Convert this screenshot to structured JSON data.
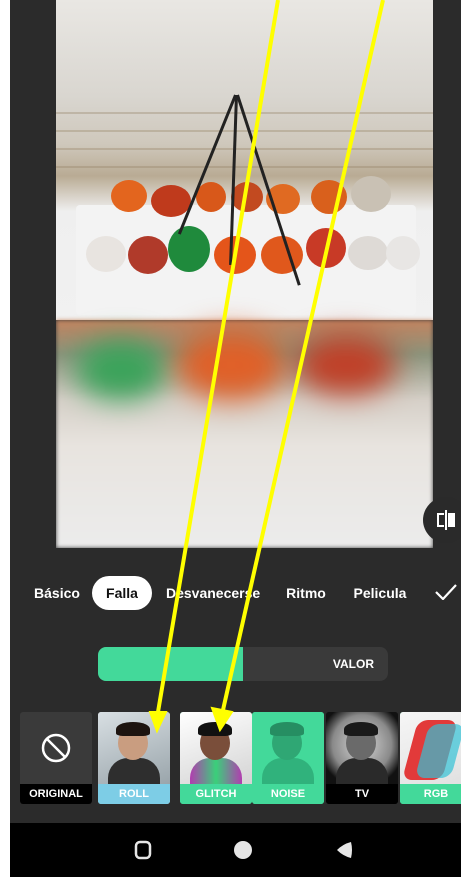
{
  "tabs": [
    {
      "label": "Básico",
      "active": false
    },
    {
      "label": "Falla",
      "active": true
    },
    {
      "label": "Desvanecerse",
      "active": false
    },
    {
      "label": "Ritmo",
      "active": false
    },
    {
      "label": "Pelicula",
      "active": false
    }
  ],
  "slider": {
    "label": "VALOR",
    "fill_fraction": 0.5
  },
  "effects": [
    {
      "label": "ORIGINAL",
      "label_color": "#000000",
      "selected": false
    },
    {
      "label": "ROLL",
      "label_color": "#7dcde6",
      "selected": false
    },
    {
      "label": "GLITCH",
      "label_color": "#43d99a",
      "selected": true
    },
    {
      "label": "NOISE",
      "label_color": "#43d99a",
      "selected": false
    },
    {
      "label": "TV",
      "label_color": "#000000",
      "selected": false
    },
    {
      "label": "RGB",
      "label_color": "#43d99a",
      "selected": false
    }
  ],
  "icons": {
    "compare": "compare-icon",
    "confirm": "check-icon",
    "none": "no-effect-icon",
    "nav": [
      "square-nav-icon",
      "circle-nav-icon",
      "back-triangle-icon"
    ]
  },
  "colors": {
    "accent": "#43d99a",
    "background": "#2b2b2b",
    "arrow": "#ffff00"
  }
}
